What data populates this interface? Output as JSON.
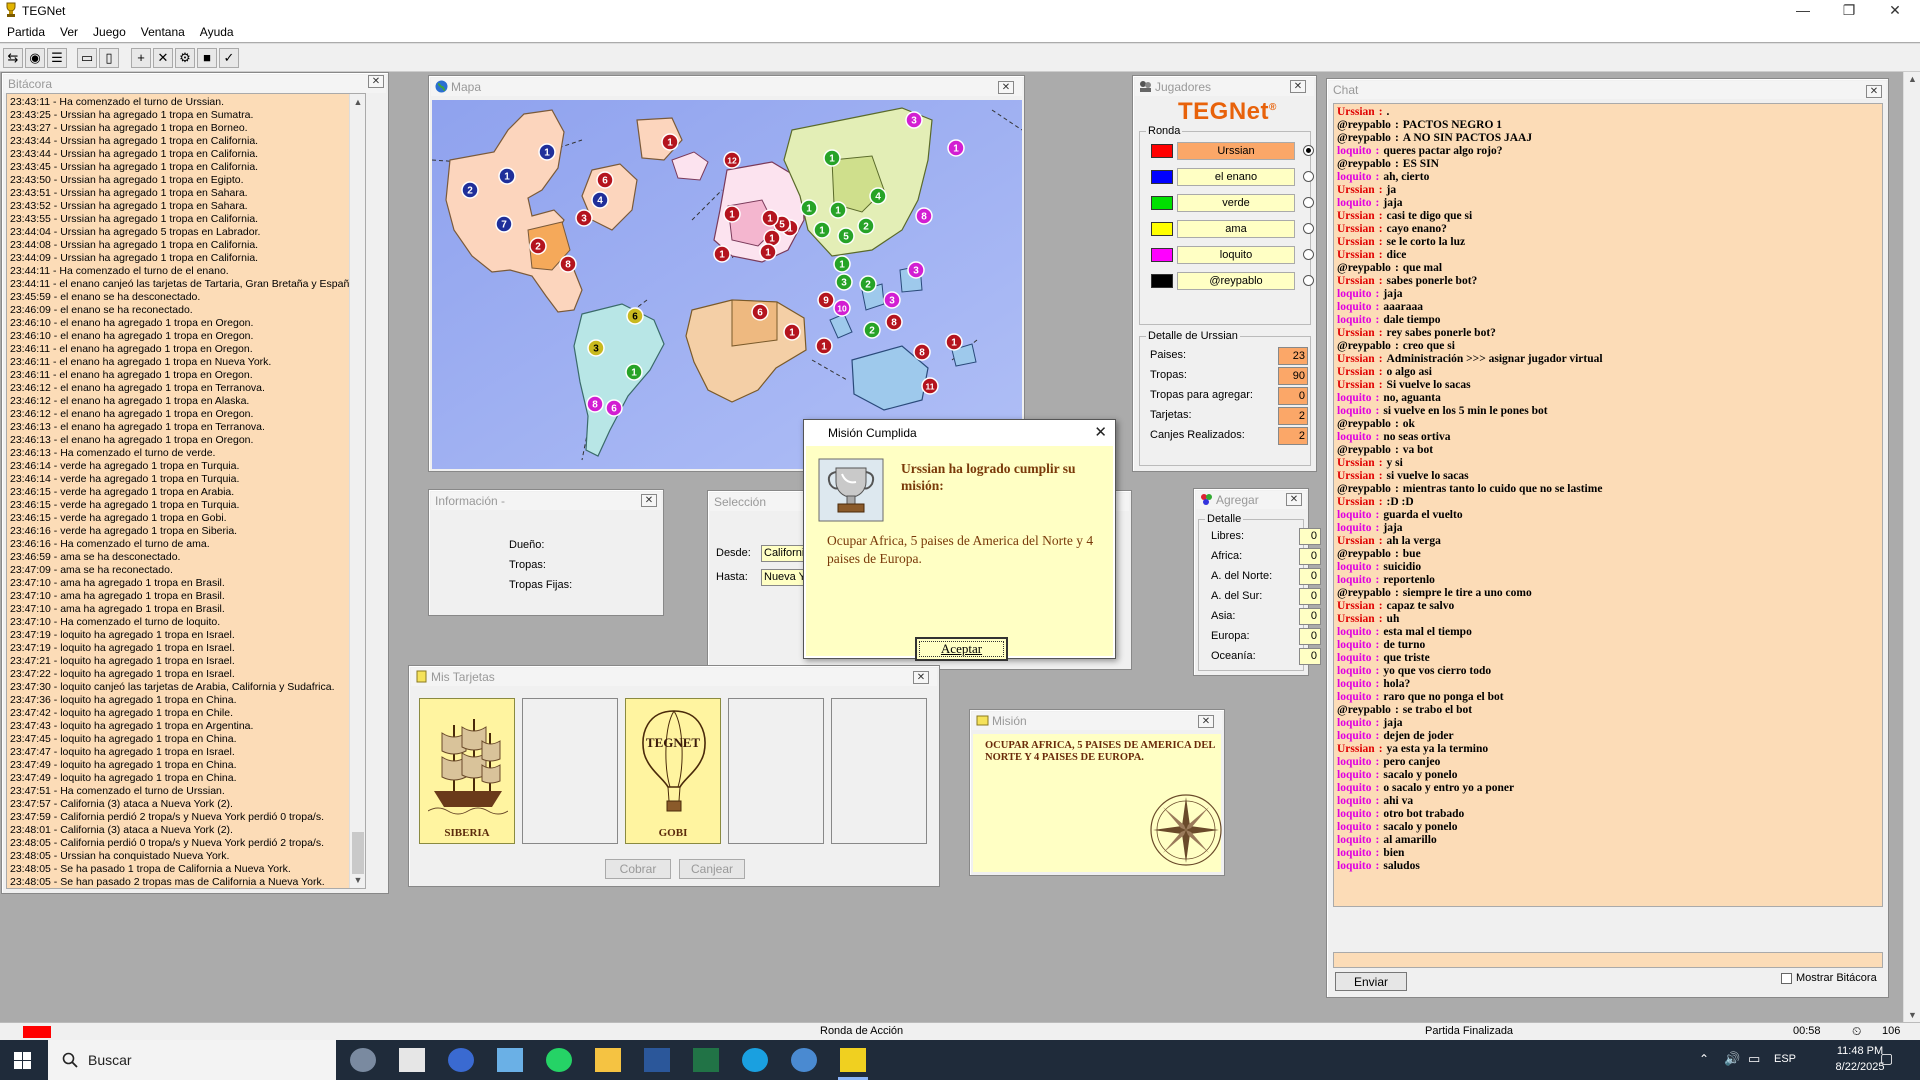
{
  "app": {
    "title": "TEGNet"
  },
  "window_controls": {
    "minimize": "—",
    "maximize": "❐",
    "close": "✕"
  },
  "menu": [
    "Partida",
    "Ver",
    "Juego",
    "Ventana",
    "Ayuda"
  ],
  "log": {
    "title": "Bitácora",
    "entries": [
      "23:43:11 - Ha comenzado el turno de Urssian.",
      "23:43:25 - Urssian ha agregado 1 tropa en Sumatra.",
      "23:43:27 - Urssian ha agregado 1 tropa en Borneo.",
      "23:43:44 - Urssian ha agregado 1 tropa en California.",
      "23:43:44 - Urssian ha agregado 1 tropa en California.",
      "23:43:45 - Urssian ha agregado 1 tropa en California.",
      "23:43:50 - Urssian ha agregado 1 tropa en Egipto.",
      "23:43:51 - Urssian ha agregado 1 tropa en Sahara.",
      "23:43:52 - Urssian ha agregado 1 tropa en Sahara.",
      "23:43:55 - Urssian ha agregado 1 tropa en California.",
      "23:44:04 - Urssian ha agregado 5 tropas en Labrador.",
      "23:44:08 - Urssian ha agregado 1 tropa en California.",
      "23:44:09 - Urssian ha agregado 1 tropa en California.",
      "23:44:11 - Ha comenzado el turno de el enano.",
      "23:44:11 - el enano canjeó las tarjetas de Tartaria, Gran Bretaña y España.",
      "23:45:59 - el enano se ha desconectado.",
      "23:46:09 - el enano se ha reconectado.",
      "23:46:10 - el enano ha agregado 1 tropa en Oregon.",
      "23:46:10 - el enano ha agregado 1 tropa en Oregon.",
      "23:46:11 - el enano ha agregado 1 tropa en Oregon.",
      "23:46:11 - el enano ha agregado 1 tropa en Nueva York.",
      "23:46:11 - el enano ha agregado 1 tropa en Oregon.",
      "23:46:12 - el enano ha agregado 1 tropa en Terranova.",
      "23:46:12 - el enano ha agregado 1 tropa en Alaska.",
      "23:46:12 - el enano ha agregado 1 tropa en Oregon.",
      "23:46:13 - el enano ha agregado 1 tropa en Terranova.",
      "23:46:13 - el enano ha agregado 1 tropa en Oregon.",
      "23:46:13 - Ha comenzado el turno de verde.",
      "23:46:14 - verde ha agregado 1 tropa en Turquia.",
      "23:46:14 - verde ha agregado 1 tropa en Turquia.",
      "23:46:15 - verde ha agregado 1 tropa en Arabia.",
      "23:46:15 - verde ha agregado 1 tropa en Turquia.",
      "23:46:15 - verde ha agregado 1 tropa en Gobi.",
      "23:46:16 - verde ha agregado 1 tropa en Siberia.",
      "23:46:16 - Ha comenzado el turno de ama.",
      "23:46:59 - ama se ha desconectado.",
      "23:47:09 - ama se ha reconectado.",
      "23:47:10 - ama ha agregado 1 tropa en Brasil.",
      "23:47:10 - ama ha agregado 1 tropa en Brasil.",
      "23:47:10 - ama ha agregado 1 tropa en Brasil.",
      "23:47:10 - Ha comenzado el turno de loquito.",
      "23:47:19 - loquito ha agregado 1 tropa en Israel.",
      "23:47:19 - loquito ha agregado 1 tropa en Israel.",
      "23:47:21 - loquito ha agregado 1 tropa en Israel.",
      "23:47:22 - loquito ha agregado 1 tropa en Israel.",
      "23:47:30 - loquito canjeó las tarjetas de Arabia, California y Sudafrica.",
      "23:47:36 - loquito ha agregado 1 tropa en China.",
      "23:47:42 - loquito ha agregado 1 tropa en Chile.",
      "23:47:43 - loquito ha agregado 1 tropa en Argentina.",
      "23:47:45 - loquito ha agregado 1 tropa en China.",
      "23:47:47 - loquito ha agregado 1 tropa en Israel.",
      "23:47:49 - loquito ha agregado 1 tropa en China.",
      "23:47:49 - loquito ha agregado 1 tropa en China.",
      "23:47:51 - Ha comenzado el turno de Urssian.",
      "23:47:57 - California (3) ataca a Nueva York (2).",
      "23:47:59 - California perdió 2 tropa/s y Nueva York perdió 0 tropa/s.",
      "23:48:01 - California (3) ataca a Nueva York (2).",
      "23:48:05 - California perdió 0 tropa/s y Nueva York perdió 2 tropa/s.",
      "23:48:05 - Urssian ha conquistado Nueva York.",
      "23:48:05 - Se ha pasado 1 tropa de California a Nueva York.",
      "23:48:05 - Se han pasado 2 tropas mas de California a Nueva York."
    ]
  },
  "map": {
    "title": "Mapa",
    "armies": [
      {
        "n": "1",
        "c": "#1f2f9a"
      },
      {
        "n": "2",
        "c": "#1f2f9a"
      },
      {
        "n": "1",
        "c": "#1f2f9a"
      },
      {
        "n": "7",
        "c": "#1f2f9a"
      },
      {
        "n": "4",
        "c": "#1f2f9a"
      },
      {
        "n": "3",
        "c": "#b4141e"
      },
      {
        "n": "2",
        "c": "#b4141e"
      },
      {
        "n": "8",
        "c": "#b4141e"
      },
      {
        "n": "6",
        "c": "#b4141e"
      },
      {
        "n": "1",
        "c": "#b4141e"
      },
      {
        "n": "12",
        "c": "#b4141e"
      },
      {
        "n": "1",
        "c": "#b4141e"
      },
      {
        "n": "1",
        "c": "#b4141e"
      },
      {
        "n": "1",
        "c": "#b4141e"
      },
      {
        "n": "1",
        "c": "#b4141e"
      },
      {
        "n": "5",
        "c": "#b4141e"
      },
      {
        "n": "1",
        "c": "#b4141e"
      },
      {
        "n": "1",
        "c": "#b4141e"
      },
      {
        "n": "6",
        "c": "#b4141e"
      },
      {
        "n": "9",
        "c": "#b4141e"
      },
      {
        "n": "1",
        "c": "#b4141e"
      },
      {
        "n": "1",
        "c": "#b4141e"
      },
      {
        "n": "8",
        "c": "#b4141e"
      },
      {
        "n": "8",
        "c": "#b4141e"
      },
      {
        "n": "1",
        "c": "#b4141e"
      },
      {
        "n": "11",
        "c": "#b4141e"
      },
      {
        "n": "1",
        "c": "#27a327"
      },
      {
        "n": "1",
        "c": "#27a327"
      },
      {
        "n": "1",
        "c": "#27a327"
      },
      {
        "n": "1",
        "c": "#27a327"
      },
      {
        "n": "4",
        "c": "#27a327"
      },
      {
        "n": "2",
        "c": "#27a327"
      },
      {
        "n": "1",
        "c": "#27a327"
      },
      {
        "n": "3",
        "c": "#27a327"
      },
      {
        "n": "2",
        "c": "#27a327"
      },
      {
        "n": "5",
        "c": "#27a327"
      },
      {
        "n": "2",
        "c": "#27a327"
      },
      {
        "n": "1",
        "c": "#27a327"
      },
      {
        "n": "3",
        "c": "#c9b91e"
      },
      {
        "n": "6",
        "c": "#c9b91e"
      },
      {
        "n": "3",
        "c": "#d21ed2"
      },
      {
        "n": "1",
        "c": "#d21ed2"
      },
      {
        "n": "8",
        "c": "#d21ed2"
      },
      {
        "n": "3",
        "c": "#d21ed2"
      },
      {
        "n": "3",
        "c": "#d21ed2"
      },
      {
        "n": "10",
        "c": "#d21ed2"
      },
      {
        "n": "8",
        "c": "#d21ed2"
      },
      {
        "n": "6",
        "c": "#d21ed2"
      }
    ]
  },
  "info": {
    "title": "Información -",
    "owner_label": "Dueño:",
    "troops_label": "Tropas:",
    "fixed_label": "Tropas Fijas:"
  },
  "selection": {
    "title": "Selección",
    "from_label": "Desde:",
    "to_label": "Hasta:",
    "from_value": "California",
    "to_value": "Nueva York"
  },
  "players": {
    "title": "Jugadores",
    "logo": "TEGNet",
    "logo_mark": "®",
    "round_label": "Ronda",
    "list": [
      {
        "name": "Urssian",
        "color": "#ff0000",
        "active": true
      },
      {
        "name": "el enano",
        "color": "#0000ff",
        "active": false
      },
      {
        "name": "verde",
        "color": "#00e000",
        "active": false
      },
      {
        "name": "ama",
        "color": "#ffff00",
        "active": false
      },
      {
        "name": "loquito",
        "color": "#ff00ff",
        "active": false
      },
      {
        "name": "@reypablo",
        "color": "#000000",
        "active": false
      }
    ],
    "detail_title": "Detalle de Urssian",
    "stats": [
      {
        "label": "Paises:",
        "value": "23"
      },
      {
        "label": "Tropas:",
        "value": "90"
      },
      {
        "label": "Tropas para agregar:",
        "value": "0"
      },
      {
        "label": "Tarjetas:",
        "value": "2"
      },
      {
        "label": "Canjes Realizados:",
        "value": "2"
      }
    ]
  },
  "add": {
    "title": "Agregar",
    "detail_label": "Detalle",
    "rows": [
      {
        "label": "Libres:",
        "value": "0"
      },
      {
        "label": "Africa:",
        "value": "0"
      },
      {
        "label": "A. del Norte:",
        "value": "0"
      },
      {
        "label": "A. del Sur:",
        "value": "0"
      },
      {
        "label": "Asia:",
        "value": "0"
      },
      {
        "label": "Europa:",
        "value": "0"
      },
      {
        "label": "Oceanía:",
        "value": "0"
      }
    ]
  },
  "cards": {
    "title": "Mis Tarjetas",
    "slots": [
      {
        "label": "SIBERIA",
        "kind": "ship"
      },
      {
        "label": "",
        "kind": "empty"
      },
      {
        "label": "GOBI",
        "kind": "balloon"
      },
      {
        "label": "",
        "kind": "empty"
      },
      {
        "label": "",
        "kind": "empty"
      }
    ],
    "balloon_text": "TEGNET",
    "collect_button": "Cobrar",
    "exchange_button": "Canjear"
  },
  "mission_panel": {
    "title": "Misión",
    "text": "OCUPAR AFRICA, 5 PAISES DE AMERICA DEL NORTE Y 4 PAISES DE EUROPA."
  },
  "chat": {
    "title": "Chat",
    "send_button": "Enviar",
    "show_log_label": "Mostrar Bitácora",
    "colors": {
      "Urssian": "#e00000",
      "@reypablo": "#000000",
      "loquito": "#e000e0"
    },
    "messages": [
      {
        "nick": "Urssian",
        "text": "."
      },
      {
        "nick": "@reypablo",
        "text": "PACTOS NEGRO 1"
      },
      {
        "nick": "@reypablo",
        "text": "A NO SIN PACTOS JAAJ"
      },
      {
        "nick": "loquito",
        "text": "queres pactar algo rojo?"
      },
      {
        "nick": "@reypablo",
        "text": "ES SIN"
      },
      {
        "nick": "loquito",
        "text": "ah, cierto"
      },
      {
        "nick": "Urssian",
        "text": "ja"
      },
      {
        "nick": "loquito",
        "text": "jaja"
      },
      {
        "nick": "Urssian",
        "text": "casi te digo que si"
      },
      {
        "nick": "Urssian",
        "text": "cayo enano?"
      },
      {
        "nick": "Urssian",
        "text": "se le corto la luz"
      },
      {
        "nick": "Urssian",
        "text": "dice"
      },
      {
        "nick": "@reypablo",
        "text": "que mal"
      },
      {
        "nick": "Urssian",
        "text": "sabes ponerle bot?"
      },
      {
        "nick": "loquito",
        "text": "jaja"
      },
      {
        "nick": "loquito",
        "text": "aaaraaa"
      },
      {
        "nick": "loquito",
        "text": "dale tiempo"
      },
      {
        "nick": "Urssian",
        "text": "rey sabes ponerle bot?"
      },
      {
        "nick": "@reypablo",
        "text": "creo que si"
      },
      {
        "nick": "Urssian",
        "text": "Administración >>> asignar jugador virtual"
      },
      {
        "nick": "Urssian",
        "text": "o algo asi"
      },
      {
        "nick": "Urssian",
        "text": "Si vuelve lo sacas"
      },
      {
        "nick": "loquito",
        "text": "no, aguanta"
      },
      {
        "nick": "loquito",
        "text": "si vuelve en los 5 min le pones bot"
      },
      {
        "nick": "@reypablo",
        "text": "ok"
      },
      {
        "nick": "loquito",
        "text": "no seas ortiva"
      },
      {
        "nick": "@reypablo",
        "text": "va bot"
      },
      {
        "nick": "Urssian",
        "text": "y si"
      },
      {
        "nick": "Urssian",
        "text": "si vuelve lo sacas"
      },
      {
        "nick": "@reypablo",
        "text": "mientras tanto lo cuido que no se lastime"
      },
      {
        "nick": "Urssian",
        "text": ":D :D"
      },
      {
        "nick": "loquito",
        "text": "guarda el vuelto"
      },
      {
        "nick": "loquito",
        "text": "jaja"
      },
      {
        "nick": "Urssian",
        "text": "ah la verga"
      },
      {
        "nick": "@reypablo",
        "text": "bue"
      },
      {
        "nick": "loquito",
        "text": "suicidio"
      },
      {
        "nick": "loquito",
        "text": "reportenlo"
      },
      {
        "nick": "@reypablo",
        "text": "siempre le tire a uno  como"
      },
      {
        "nick": "Urssian",
        "text": "capaz te salvo"
      },
      {
        "nick": "Urssian",
        "text": "uh"
      },
      {
        "nick": "loquito",
        "text": "esta mal el tiempo"
      },
      {
        "nick": "loquito",
        "text": "de turno"
      },
      {
        "nick": "loquito",
        "text": "que triste"
      },
      {
        "nick": "loquito",
        "text": "yo que vos cierro todo"
      },
      {
        "nick": "loquito",
        "text": "hola?"
      },
      {
        "nick": "loquito",
        "text": "raro que no ponga el bot"
      },
      {
        "nick": "@reypablo",
        "text": "se trabo el bot"
      },
      {
        "nick": "loquito",
        "text": "jaja"
      },
      {
        "nick": "loquito",
        "text": "dejen de joder"
      },
      {
        "nick": "Urssian",
        "text": "ya esta ya la termino"
      },
      {
        "nick": "loquito",
        "text": "pero canjeo"
      },
      {
        "nick": "loquito",
        "text": "sacalo y ponelo"
      },
      {
        "nick": "loquito",
        "text": "o sacalo y entro yo a poner"
      },
      {
        "nick": "loquito",
        "text": "ahi va"
      },
      {
        "nick": "loquito",
        "text": "otro bot trabado"
      },
      {
        "nick": "loquito",
        "text": "sacalo y ponelo"
      },
      {
        "nick": "loquito",
        "text": "al amarillo"
      },
      {
        "nick": "loquito",
        "text": "bien"
      },
      {
        "nick": "loquito",
        "text": "saludos"
      }
    ]
  },
  "modal": {
    "title": "Misión Cumplida",
    "heading": "Urssian ha logrado cumplir su misión:",
    "mission": "Ocupar Africa, 5 paises de America del Norte y 4 paises de Europa.",
    "ok_button": "Aceptar"
  },
  "status": {
    "phase": "Ronda de Acción",
    "game": "Partida Finalizada",
    "timer": "00:58",
    "count": "106",
    "color": "#ff0000"
  },
  "taskbar": {
    "search": "Buscar",
    "lang": "ESP",
    "time": "11:48 PM",
    "date": "8/22/2025"
  }
}
